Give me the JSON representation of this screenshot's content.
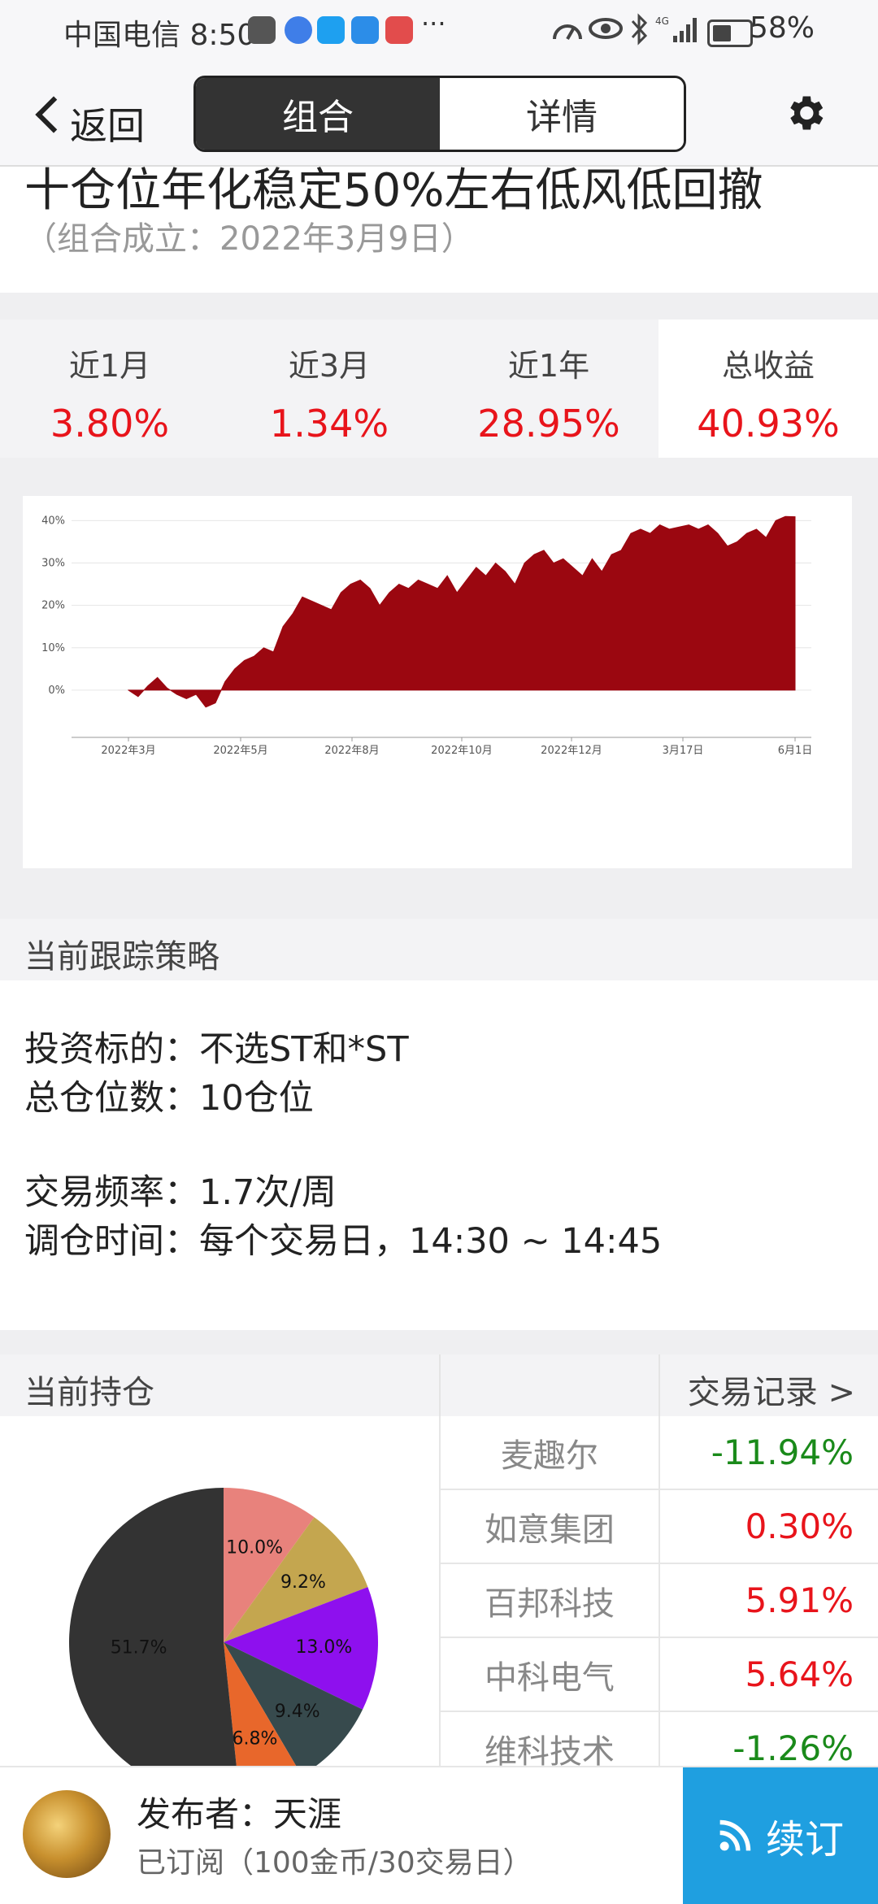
{
  "status_bar": {
    "carrier": "中国电信",
    "time": "8:50",
    "battery": "58%",
    "icons": [
      "huawei-icon",
      "browser-icon",
      "search-app-icon",
      "weather-icon",
      "reader-icon",
      "more-icon",
      "speedometer-icon",
      "eye-icon",
      "bluetooth-icon",
      "4g-signal-icon",
      "battery-icon"
    ]
  },
  "nav": {
    "back_label": "返回",
    "tabs": [
      "组合",
      "详情"
    ],
    "active_tab": 0
  },
  "portfolio": {
    "title": "十仓位年化稳定50%左右低风低回撤",
    "established": "（组合成立：2022年3月9日）"
  },
  "returns": [
    {
      "label": "近1月",
      "value": "3.80%"
    },
    {
      "label": "近3月",
      "value": "1.34%"
    },
    {
      "label": "近1年",
      "value": "28.95%"
    },
    {
      "label": "总收益",
      "value": "40.93%"
    }
  ],
  "chart_data": {
    "type": "area",
    "x_ticks": [
      "2022年3月",
      "2022年5月",
      "2022年8月",
      "2022年10月",
      "2022年12月",
      "3月17日",
      "6月1日"
    ],
    "y_ticks": [
      "0%",
      "10%",
      "20%",
      "30%",
      "40%"
    ],
    "ylim": [
      -5,
      42
    ],
    "color": "#9b0710",
    "series": [
      {
        "values": [
          0,
          -1.5,
          1,
          3,
          0.5,
          -1,
          -2,
          -1,
          -4,
          -3,
          2,
          5,
          7,
          8,
          10,
          9,
          15,
          18,
          22,
          21,
          20,
          19,
          23,
          25,
          26,
          24,
          20,
          23,
          25,
          24,
          26,
          25,
          24,
          27,
          23,
          26,
          29,
          27,
          30,
          28,
          25,
          30,
          32,
          33,
          30,
          31,
          29,
          27,
          31,
          28,
          32,
          33,
          37,
          38,
          37,
          39,
          38,
          38.5,
          39,
          38,
          39,
          37,
          34,
          35,
          37,
          38,
          36,
          40,
          41,
          40.93
        ]
      }
    ]
  },
  "strategy": {
    "heading": "当前跟踪策略",
    "lines": [
      "投资标的：不选ST和*ST",
      "总仓位数：10仓位",
      "交易频率：1.7次/周",
      "调仓时间：每个交易日，14:30 ~ 14:45"
    ]
  },
  "holdings": {
    "heading": "当前持仓",
    "trade_link": "交易记录 >",
    "pie": [
      {
        "label": "10.0%",
        "value": 10.0,
        "color": "#e8827c"
      },
      {
        "label": "9.2%",
        "value": 9.2,
        "color": "#c4a64f"
      },
      {
        "label": "13.0%",
        "value": 13.0,
        "color": "#8e10ee"
      },
      {
        "label": "9.4%",
        "value": 9.4,
        "color": "#374a4d"
      },
      {
        "label": "6.8%",
        "value": 6.8,
        "color": "#e8672b"
      },
      {
        "label": "51.7%",
        "value": 51.7,
        "color": "#333333"
      }
    ],
    "stocks": [
      {
        "name": "麦趣尔",
        "change": "-11.94%",
        "color": "#1a8a1a"
      },
      {
        "name": "如意集团",
        "change": "0.30%",
        "color": "#e8141b"
      },
      {
        "name": "百邦科技",
        "change": "5.91%",
        "color": "#e8141b"
      },
      {
        "name": "中科电气",
        "change": "5.64%",
        "color": "#e8141b"
      },
      {
        "name": "维科技术",
        "change": "-1.26%",
        "color": "#1a8a1a"
      }
    ]
  },
  "footer": {
    "publisher": "发布者：天涯",
    "subscription": "已订阅（100金币/30交易日）",
    "subscribe_button": "续订"
  }
}
